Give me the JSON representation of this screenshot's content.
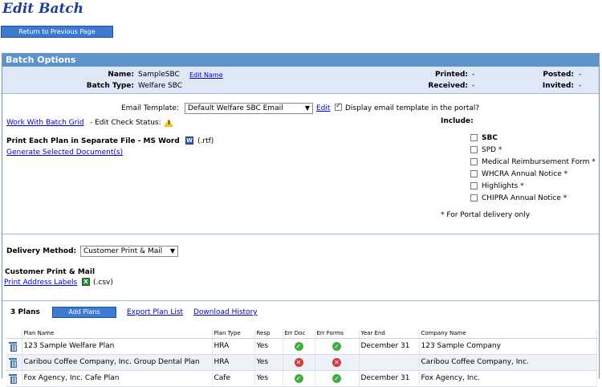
{
  "page": {
    "title": "Edit Batch",
    "return_label": "Return to Previous Page"
  },
  "panel": {
    "title": "Batch Options"
  },
  "batch": {
    "name_label": "Name:",
    "name": "SampleSBC",
    "edit_name": "Edit Name",
    "type_label": "Batch Type:",
    "type": "Welfare SBC",
    "printed_label": "Printed:",
    "printed": "-",
    "received_label": "Received:",
    "received": "-",
    "posted_label": "Posted:",
    "posted": "-",
    "invited_label": "Invited:",
    "invited": "-"
  },
  "email": {
    "label": "Email Template:",
    "selected": "Default Welfare SBC Email",
    "edit": "Edit",
    "display_portal": "Display email template in the portal?"
  },
  "grid": {
    "link": "Work With Batch Grid",
    "status": "- Edit Check Status:"
  },
  "print": {
    "heading": "Print Each Plan in Separate File - MS Word",
    "ext": "(.rtf)",
    "generate": "Generate Selected Document(s)"
  },
  "include": {
    "heading": "Include:",
    "items": [
      {
        "label": "SBC",
        "bold": true
      },
      {
        "label": "SPD *"
      },
      {
        "label": "Medical Reimbursement Form *"
      },
      {
        "label": "WHCRA Annual Notice *"
      },
      {
        "label": "Highlights *"
      },
      {
        "label": "CHIPRA Annual Notice *"
      }
    ],
    "note": "* For Portal delivery only"
  },
  "delivery": {
    "label": "Delivery Method:",
    "selected": "Customer Print & Mail",
    "section_title": "Customer Print & Mail",
    "labels_link": "Print Address Labels",
    "ext": "(.csv)"
  },
  "plans": {
    "count": "3 Plans",
    "add": "Add Plans",
    "export": "Export Plan List",
    "history": "Download History",
    "columns": [
      "Plan Name",
      "Plan Type",
      "Resp",
      "Err Doc",
      "Err Forms",
      "Year End",
      "Company Name"
    ],
    "rows": [
      {
        "name": "123 Sample Welfare Plan",
        "type": "HRA",
        "resp": "Yes",
        "err_doc": "ok",
        "err_forms": "ok",
        "year_end": "December 31",
        "company": "123 Sample Company"
      },
      {
        "name": "Caribou Coffee Company, Inc. Group Dental Plan",
        "type": "HRA",
        "resp": "Yes",
        "err_doc": "error",
        "err_forms": "error",
        "year_end": "",
        "company": "Caribou Coffee Company, Inc."
      },
      {
        "name": "Fox Agency, Inc. Cafe Plan",
        "type": "Cafe",
        "resp": "Yes",
        "err_doc": "ok",
        "err_forms": "ok",
        "year_end": "December 31",
        "company": "Fox Agency, Inc."
      }
    ]
  }
}
